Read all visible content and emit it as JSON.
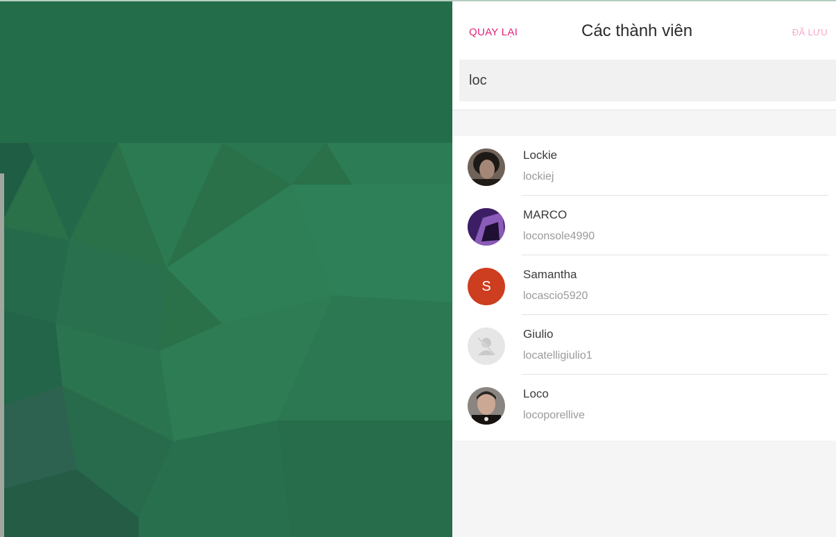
{
  "panel": {
    "back_label": "QUAY LẠI",
    "title": "Các thành viên",
    "save_label": "ĐÃ LƯU"
  },
  "search": {
    "value": "loc"
  },
  "members": [
    {
      "name": "Lockie",
      "handle": "lockiej",
      "avatar": "photo-avatar"
    },
    {
      "name": "MARCO",
      "handle": "loconsole4990",
      "avatar": "photo-avatar"
    },
    {
      "name": "Samantha",
      "handle": "locascio5920",
      "avatar": "letter-avatar",
      "initial": "S",
      "color": "#cd3d1f"
    },
    {
      "name": "Giulio",
      "handle": "locatelligiulio1",
      "avatar": "default-avatar-icon"
    },
    {
      "name": "Loco",
      "handle": "locoporellive",
      "avatar": "photo-avatar"
    }
  ],
  "colors": {
    "accent": "#e2237a",
    "accent_disabled": "#f4a9cb",
    "background_green": "#236c4a"
  }
}
